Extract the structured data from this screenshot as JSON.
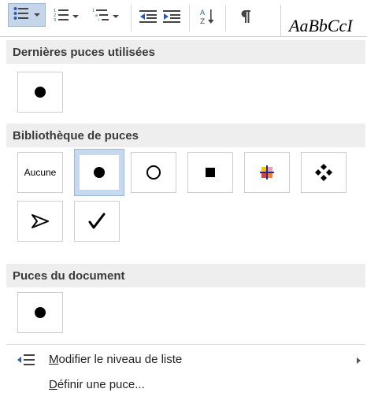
{
  "ribbon": {
    "style_preview_text": "AaBbCcI"
  },
  "sections": {
    "recent": {
      "title": "Dernières puces utilisées"
    },
    "library": {
      "title": "Bibliothèque de puces",
      "none_label": "Aucune"
    },
    "document": {
      "title": "Puces du document"
    }
  },
  "menu": {
    "change_level": {
      "prefix": "M",
      "rest": "odifier le niveau de liste"
    },
    "define_bullet": {
      "prefix": "D",
      "rest": "éfinir une puce..."
    }
  },
  "colors": {
    "accent": "#c6d9ef",
    "section_bg": "#eeeeee"
  }
}
